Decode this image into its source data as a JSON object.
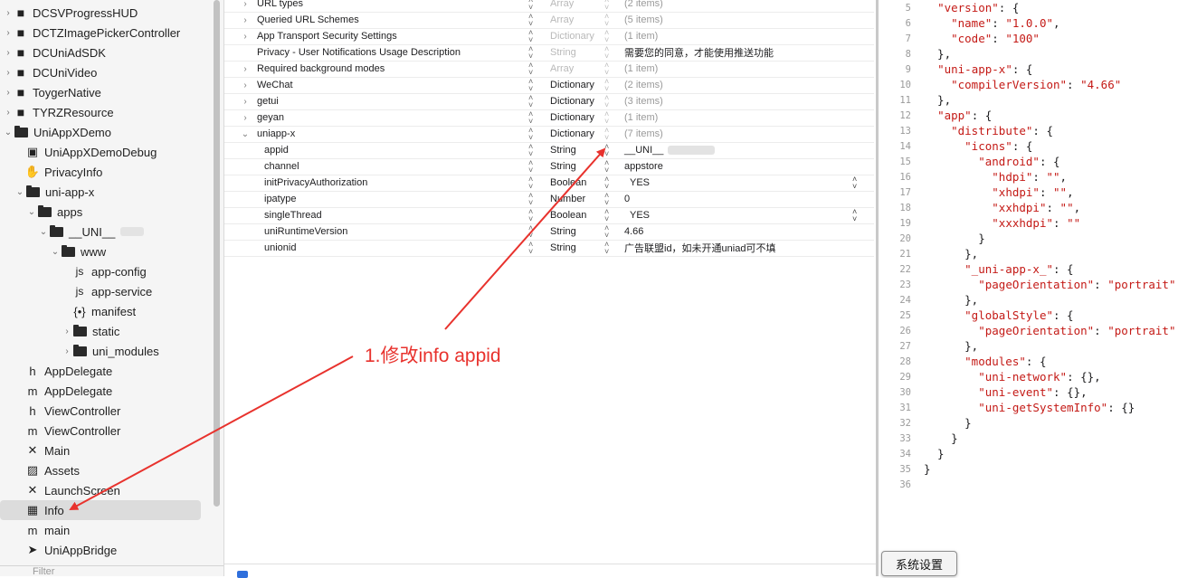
{
  "navigator": {
    "items": [
      {
        "label": "DCSVProgressHUD",
        "icon": "package-icon",
        "disclosure": "collapsed"
      },
      {
        "label": "DCTZImagePickerController",
        "icon": "package-icon",
        "disclosure": "collapsed"
      },
      {
        "label": "DCUniAdSDK",
        "icon": "package-icon",
        "disclosure": "collapsed"
      },
      {
        "label": "DCUniVideo",
        "icon": "package-icon",
        "disclosure": "collapsed"
      },
      {
        "label": "ToygerNative",
        "icon": "package-icon",
        "disclosure": "collapsed"
      },
      {
        "label": "TYRZResource",
        "icon": "package-icon",
        "disclosure": "collapsed"
      },
      {
        "label": "UniAppXDemo",
        "icon": "folder-icon",
        "disclosure": "expanded"
      },
      {
        "label": "UniAppXDemoDebug",
        "icon": "entitlements-icon",
        "disclosure": ""
      },
      {
        "label": "PrivacyInfo",
        "icon": "hand-icon",
        "disclosure": ""
      },
      {
        "label": "uni-app-x",
        "icon": "folder-icon",
        "disclosure": "expanded"
      },
      {
        "label": "apps",
        "icon": "folder-icon",
        "disclosure": "expanded"
      },
      {
        "label": "__UNI__",
        "icon": "folder-icon",
        "disclosure": "expanded"
      },
      {
        "label": "www",
        "icon": "folder-icon",
        "disclosure": "expanded"
      },
      {
        "label": "app-config",
        "icon": "js-icon",
        "disclosure": ""
      },
      {
        "label": "app-service",
        "icon": "js-icon",
        "disclosure": ""
      },
      {
        "label": "manifest",
        "icon": "json-icon",
        "disclosure": ""
      },
      {
        "label": "static",
        "icon": "folder-icon",
        "disclosure": "collapsed"
      },
      {
        "label": "uni_modules",
        "icon": "folder-icon",
        "disclosure": "collapsed"
      },
      {
        "label": "AppDelegate",
        "icon": "header-h-icon",
        "disclosure": ""
      },
      {
        "label": "AppDelegate",
        "icon": "source-m-icon",
        "disclosure": ""
      },
      {
        "label": "ViewController",
        "icon": "header-h-icon",
        "disclosure": ""
      },
      {
        "label": "ViewController",
        "icon": "source-m-icon",
        "disclosure": ""
      },
      {
        "label": "Main",
        "icon": "storyboard-icon",
        "disclosure": ""
      },
      {
        "label": "Assets",
        "icon": "assets-icon",
        "disclosure": ""
      },
      {
        "label": "LaunchScreen",
        "icon": "storyboard-icon",
        "disclosure": ""
      },
      {
        "label": "Info",
        "icon": "table-icon",
        "disclosure": "",
        "selected": true
      },
      {
        "label": "main",
        "icon": "source-m-icon",
        "disclosure": ""
      },
      {
        "label": "UniAppBridge",
        "icon": "swift-icon",
        "disclosure": ""
      }
    ],
    "filter_placeholder": "Filter"
  },
  "plist": {
    "rows": [
      {
        "key": "URL types",
        "type": "Array",
        "value": "(2 items)",
        "disclosure": "collapsed",
        "dim": true
      },
      {
        "key": "Queried URL Schemes",
        "type": "Array",
        "value": "(5 items)",
        "disclosure": "collapsed",
        "dim": true
      },
      {
        "key": "App Transport Security Settings",
        "type": "Dictionary",
        "value": "(1 item)",
        "disclosure": "collapsed",
        "dim": true
      },
      {
        "key": "Privacy - User Notifications Usage Description",
        "type": "String",
        "value": "需要您的同意，才能使用推送功能",
        "disclosure": "",
        "dim": true
      },
      {
        "key": "Required background modes",
        "type": "Array",
        "value": "(1 item)",
        "disclosure": "collapsed",
        "dim": true
      },
      {
        "key": "WeChat",
        "type": "Dictionary",
        "value": "(2 items)",
        "disclosure": "collapsed",
        "dim": false
      },
      {
        "key": "getui",
        "type": "Dictionary",
        "value": "(3 items)",
        "disclosure": "collapsed",
        "dim": false
      },
      {
        "key": "geyan",
        "type": "Dictionary",
        "value": "(1 item)",
        "disclosure": "collapsed",
        "dim": false
      },
      {
        "key": "uniapp-x",
        "type": "Dictionary",
        "value": "(7 items)",
        "disclosure": "expanded",
        "dim": false
      },
      {
        "key": "appid",
        "type": "String",
        "value": "__UNI__",
        "disclosure": "",
        "child": true
      },
      {
        "key": "channel",
        "type": "String",
        "value": "appstore",
        "disclosure": "",
        "child": true
      },
      {
        "key": "initPrivacyAuthorization",
        "type": "Boolean",
        "value": "YES",
        "disclosure": "",
        "child": true,
        "bool": true
      },
      {
        "key": "ipatype",
        "type": "Number",
        "value": "0",
        "disclosure": "",
        "child": true
      },
      {
        "key": "singleThread",
        "type": "Boolean",
        "value": "YES",
        "disclosure": "",
        "child": true,
        "bool": true
      },
      {
        "key": "uniRuntimeVersion",
        "type": "String",
        "value": "4.66",
        "disclosure": "",
        "child": true
      },
      {
        "key": "unionid",
        "type": "String",
        "value": "广告联盟id，如未开通uniad可不填",
        "disclosure": "",
        "child": true
      }
    ]
  },
  "code": {
    "lines": [
      {
        "n": "5",
        "t": "  \"version\": {"
      },
      {
        "n": "6",
        "t": "    \"name\": \"1.0.0\","
      },
      {
        "n": "7",
        "t": "    \"code\": \"100\""
      },
      {
        "n": "8",
        "t": "  },"
      },
      {
        "n": "9",
        "t": "  \"uni-app-x\": {"
      },
      {
        "n": "10",
        "t": "    \"compilerVersion\": \"4.66\""
      },
      {
        "n": "11",
        "t": "  },"
      },
      {
        "n": "12",
        "t": "  \"app\": {"
      },
      {
        "n": "13",
        "t": "    \"distribute\": {"
      },
      {
        "n": "14",
        "t": "      \"icons\": {"
      },
      {
        "n": "15",
        "t": "        \"android\": {"
      },
      {
        "n": "16",
        "t": "          \"hdpi\": \"\","
      },
      {
        "n": "17",
        "t": "          \"xhdpi\": \"\","
      },
      {
        "n": "18",
        "t": "          \"xxhdpi\": \"\","
      },
      {
        "n": "19",
        "t": "          \"xxxhdpi\": \"\""
      },
      {
        "n": "20",
        "t": "        }"
      },
      {
        "n": "21",
        "t": "      },"
      },
      {
        "n": "22",
        "t": "      \"_uni-app-x_\": {"
      },
      {
        "n": "23",
        "t": "        \"pageOrientation\": \"portrait\""
      },
      {
        "n": "24",
        "t": "      },"
      },
      {
        "n": "25",
        "t": "      \"globalStyle\": {"
      },
      {
        "n": "26",
        "t": "        \"pageOrientation\": \"portrait\""
      },
      {
        "n": "27",
        "t": "      },"
      },
      {
        "n": "28",
        "t": "      \"modules\": {"
      },
      {
        "n": "29",
        "t": "        \"uni-network\": {},"
      },
      {
        "n": "30",
        "t": "        \"uni-event\": {},"
      },
      {
        "n": "31",
        "t": "        \"uni-getSystemInfo\": {}"
      },
      {
        "n": "32",
        "t": "      }"
      },
      {
        "n": "33",
        "t": "    }"
      },
      {
        "n": "34",
        "t": "  }"
      },
      {
        "n": "35",
        "t": "}"
      },
      {
        "n": "36",
        "t": ""
      }
    ]
  },
  "tooltip": {
    "label": "系统设置"
  },
  "annotation": {
    "text": "1.修改info appid",
    "color": "#e8322d"
  }
}
